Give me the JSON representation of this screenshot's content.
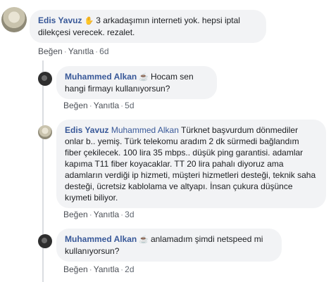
{
  "comments": [
    {
      "author": "Edis Yavuz",
      "emoji": "✋",
      "text": "3 arkadaşımın interneti yok. hepsi iptal dilekçesi verecek. rezalet.",
      "like": "Beğen",
      "reply": "Yanıtla",
      "time": "6d"
    }
  ],
  "replies": [
    {
      "author": "Muhammed Alkan",
      "emoji": "☕",
      "text": "Hocam sen hangi firmayı kullanıyorsun?",
      "like": "Beğen",
      "reply": "Yanıtla",
      "time": "5d"
    },
    {
      "author": "Edis Yavuz",
      "mention": "Muhammed Alkan",
      "text": "Türknet başvurdum dönmediler onlar b.. yemiş. Türk telekomu aradım 2 dk sürmedi bağlandım fiber çekilecek. 100 lira 35 mbps.. düşük ping garantisi. adamlar kapıma T11 fiber koyacaklar. TT 20 lira pahalı diyoruz ama adamların verdiği ip hizmeti, müşteri hizmetleri desteği, teknik saha desteği, ücretsiz kablolama ve altyapı. İnsan çukura düşünce kıymeti biliyor.",
      "like": "Beğen",
      "reply": "Yanıtla",
      "time": "3d"
    },
    {
      "author": "Muhammed Alkan",
      "emoji": "☕",
      "text": "anlamadım şimdi netspeed mi kullanıyorsun?",
      "like": "Beğen",
      "reply": "Yanıtla",
      "time": "2d"
    }
  ],
  "separator": "·"
}
